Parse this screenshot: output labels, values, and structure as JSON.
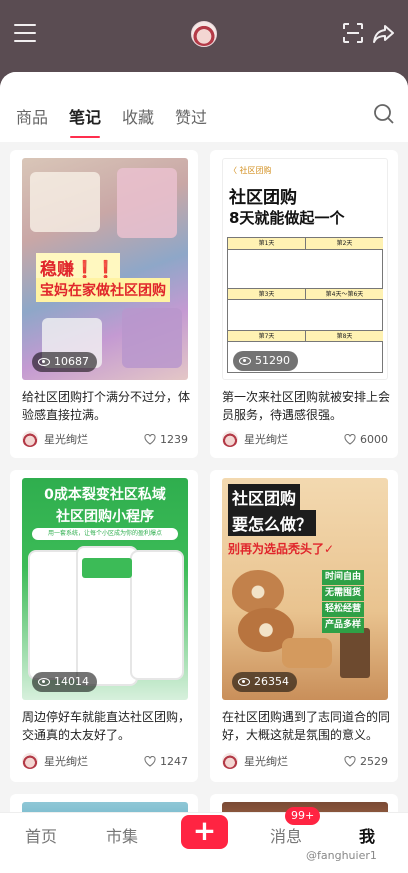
{
  "header": {
    "menu_icon": "menu-icon",
    "scan_icon": "scan-icon",
    "share_icon": "share-icon"
  },
  "tabs": [
    {
      "label": "商品"
    },
    {
      "label": "笔记",
      "active": true
    },
    {
      "label": "收藏"
    },
    {
      "label": "赞过"
    }
  ],
  "accent_color": "#ff2442",
  "cards": [
    {
      "cover_title_1": "稳赚❗❗",
      "cover_title_2": "宝妈在家做社区团购",
      "views": "10687",
      "desc": "给社区团购打个满分不过分，体验感直接拉满。",
      "author": "星光绚烂",
      "likes": "1239"
    },
    {
      "cover_nav": "〈 社区团购",
      "cover_title_1": "社区团购",
      "cover_title_2": "8天就能做起一个",
      "days": [
        "第1天",
        "第2天",
        "第3天",
        "第4天～第6天",
        "第7天",
        "第8天"
      ],
      "views": "51290",
      "desc": "第一次来社区团购就被安排上会员服务，待遇感很强。",
      "author": "星光绚烂",
      "likes": "6000"
    },
    {
      "cover_title_1": "0成本裂变社区私域",
      "cover_title_2": "社区团购小程序",
      "cover_sub": "用一套系统，让每个小区成为你的盈利爆点",
      "views": "14014",
      "desc": "周边停好车就能直达社区团购，交通真的太友好了。",
      "author": "星光绚烂",
      "likes": "1247"
    },
    {
      "cover_title_1": "社区团购",
      "cover_title_2": "要怎么做？",
      "cover_title_3": "别再为选品秃头了✓",
      "cover_tags": [
        "时间自由",
        "无需囤货",
        "轻松经营",
        "产品多样"
      ],
      "views": "26354",
      "desc": "在社区团购遇到了志同道合的同好，大概这就是氛围的意义。",
      "author": "星光绚烂",
      "likes": "2529"
    }
  ],
  "bottom_nav": {
    "home": "首页",
    "market": "市集",
    "plus": "+",
    "messages": "消息",
    "messages_badge": "99+",
    "me": "我"
  },
  "watermark": "@fanghuier1"
}
